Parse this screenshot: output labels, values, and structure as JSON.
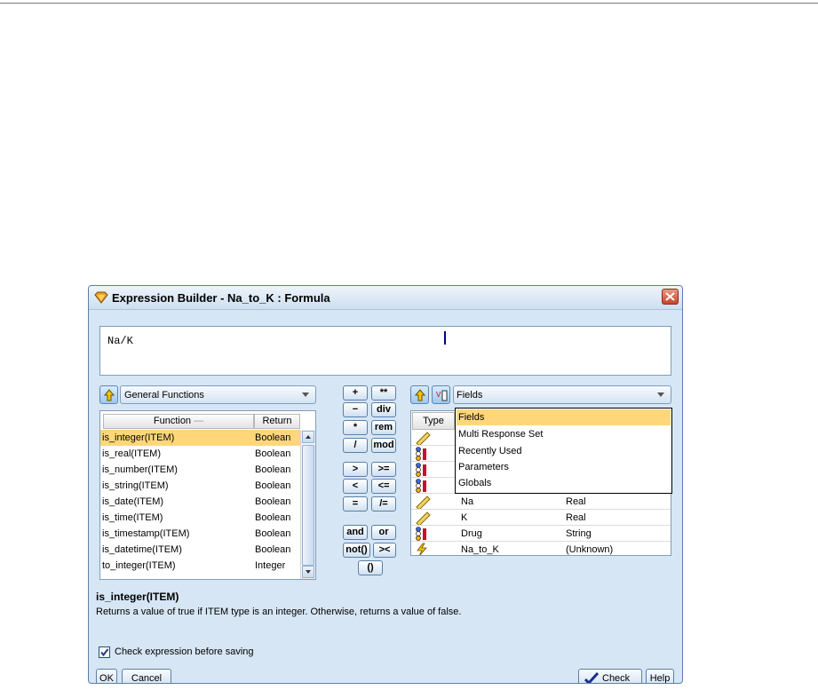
{
  "dialog": {
    "title": "Expression Builder - Na_to_K : Formula",
    "expression": "Na/K"
  },
  "functions": {
    "category": "General Functions",
    "headers": {
      "function": "Function",
      "return": "Return"
    },
    "rows": [
      {
        "name": "is_integer(ITEM)",
        "ret": "Boolean"
      },
      {
        "name": "is_real(ITEM)",
        "ret": "Boolean"
      },
      {
        "name": "is_number(ITEM)",
        "ret": "Boolean"
      },
      {
        "name": "is_string(ITEM)",
        "ret": "Boolean"
      },
      {
        "name": "is_date(ITEM)",
        "ret": "Boolean"
      },
      {
        "name": "is_time(ITEM)",
        "ret": "Boolean"
      },
      {
        "name": "is_timestamp(ITEM)",
        "ret": "Boolean"
      },
      {
        "name": "is_datetime(ITEM)",
        "ret": "Boolean"
      },
      {
        "name": "to_integer(ITEM)",
        "ret": "Integer"
      }
    ]
  },
  "operators": [
    [
      "+",
      "**"
    ],
    [
      "−",
      "div"
    ],
    [
      "*",
      "rem"
    ],
    [
      "/",
      "mod"
    ],
    [
      ">",
      ">="
    ],
    [
      "<",
      "<="
    ],
    [
      "=",
      "/="
    ],
    [
      "and",
      "or"
    ],
    [
      "not()",
      "><"
    ],
    [
      "()"
    ]
  ],
  "fields": {
    "selector": "Fields",
    "type_header": "Type",
    "options": [
      "Fields",
      "Multi Response Set",
      "Recently Used",
      "Parameters",
      "Globals"
    ],
    "rows": [
      {
        "icon": "continuous-ruler-icon",
        "name": "Na",
        "storage": "Real"
      },
      {
        "icon": "continuous-ruler-icon",
        "name": "K",
        "storage": "Real"
      },
      {
        "icon": "nominal-field-icon",
        "name": "Drug",
        "storage": "String"
      },
      {
        "icon": "derived-field-icon",
        "name": "Na_to_K",
        "storage": "(Unknown)"
      }
    ]
  },
  "description": {
    "title": "is_integer(ITEM)",
    "text": "Returns a value of true if ITEM type is an integer. Otherwise, returns a value of false."
  },
  "check_option": {
    "label": "Check expression before saving",
    "checked": true
  },
  "buttons": {
    "ok": "OK",
    "cancel": "Cancel",
    "check": "Check",
    "help": "Help"
  },
  "colors": {
    "selection": "#ffd77a",
    "dialog_bg": "#d7e6f4"
  }
}
